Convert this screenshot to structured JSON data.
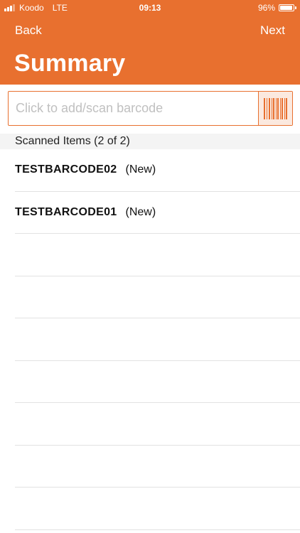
{
  "status_bar": {
    "carrier": "Koodo",
    "network": "LTE",
    "time": "09:13",
    "battery": "96%"
  },
  "nav": {
    "back_label": "Back",
    "next_label": "Next",
    "title": "Summary"
  },
  "barcode": {
    "placeholder": "Click to add/scan barcode",
    "value": ""
  },
  "section": {
    "title": "Scanned Items (2 of 2)"
  },
  "items": [
    {
      "code": "TESTBARCODE02",
      "status": "(New)"
    },
    {
      "code": "TESTBARCODE01",
      "status": "(New)"
    }
  ],
  "colors": {
    "accent": "#E8702F",
    "scan_button_bg": "#FBE9DF"
  },
  "icons": {
    "scan": "barcode-icon"
  }
}
